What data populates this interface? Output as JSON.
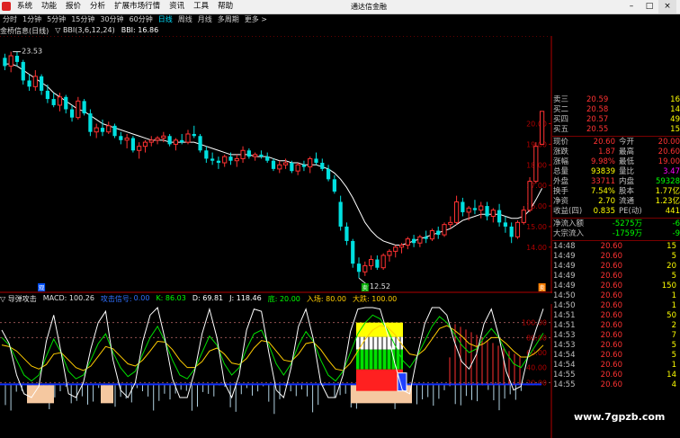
{
  "window": {
    "menu": [
      "系统",
      "功能",
      "报价",
      "分析",
      "扩展市场行情",
      "资讯",
      "工具",
      "帮助"
    ],
    "title": "通达信金融终",
    "controls": [
      "–",
      "□",
      "×"
    ]
  },
  "periods": {
    "tabs": [
      "分时",
      "1分钟",
      "5分钟",
      "15分钟",
      "30分钟",
      "60分钟",
      "日线",
      "周线",
      "月线",
      "多周期",
      "更多 >"
    ],
    "active": "日线"
  },
  "price_legend": {
    "name": "金桥信息(日线)",
    "indicator": "▽ BBI(3,6,12,24)",
    "bbi": "BBI: 16.86"
  },
  "indicator_legend": {
    "name": "▽ 导弹攻击",
    "macd": "MACD: 100.26",
    "flag": "攻击信号:",
    "flag_val": "0.00",
    "k": "K: 86.03",
    "d": "D: 69.81",
    "j": "J: 118.46",
    "low": "底: 20.00",
    "enter": "入场: 80.00",
    "big": "大跌: 100.00"
  },
  "price_axis": [
    "20.00",
    "19.00",
    "18.00",
    "17.00",
    "16.00",
    "15.00",
    "14.00"
  ],
  "indicator_axis": [
    "100.00",
    "80.00",
    "60.00",
    "40.00",
    "20.00"
  ],
  "annotations": {
    "high_label": "23.53",
    "low_label": "12.52",
    "marker_left": "观",
    "marker_right": "卖"
  },
  "quotes": {
    "top_rows": [
      {
        "label": "卖三",
        "price": "20.59",
        "vol": "16"
      },
      {
        "label": "买二",
        "price": "20.58",
        "vol": "14"
      },
      {
        "label": "买四",
        "price": "20.57",
        "vol": "49"
      },
      {
        "label": "买五",
        "price": "20.55",
        "vol": "15"
      }
    ],
    "stats": [
      {
        "l1": "现价",
        "v1": "20.60",
        "l2": "今开",
        "v2": "20.00"
      },
      {
        "l1": "涨跌",
        "v1": "1.87",
        "l2": "最高",
        "v2": "20.60"
      },
      {
        "l1": "涨幅",
        "v1": "9.98%",
        "l2": "最低",
        "v2": "19.00"
      },
      {
        "l1": "总量",
        "v1": "93839",
        "l2": "量比",
        "v2": "3.47"
      },
      {
        "l1": "外盘",
        "v1": "33711",
        "l2": "内盘",
        "v2": "59328"
      },
      {
        "l1": "换手",
        "v1": "7.54%",
        "l2": "股本",
        "v2": "1.77亿"
      },
      {
        "l1": "净资",
        "v1": "2.70",
        "l2": "流通",
        "v2": "1.23亿"
      },
      {
        "l1": "收益(四)",
        "v1": "0.835",
        "l2": "PE(动)",
        "v2": "441"
      }
    ],
    "flows": [
      {
        "label": "净流入额",
        "v1": "-5275万",
        "v2": "-6"
      },
      {
        "label": "大宗流入",
        "v1": "-1759万",
        "v2": "-9"
      }
    ],
    "ticks": [
      {
        "time": "14:48",
        "price": "20.60",
        "vol": "15"
      },
      {
        "time": "14:49",
        "price": "20.60",
        "vol": "5"
      },
      {
        "time": "14:49",
        "price": "20.60",
        "vol": "20"
      },
      {
        "time": "14:49",
        "price": "20.60",
        "vol": "5"
      },
      {
        "time": "14:49",
        "price": "20.60",
        "vol": "150"
      },
      {
        "time": "14:50",
        "price": "20.60",
        "vol": "1"
      },
      {
        "time": "14:50",
        "price": "20.60",
        "vol": "1"
      },
      {
        "time": "14:51",
        "price": "20.60",
        "vol": "50"
      },
      {
        "time": "14:51",
        "price": "20.60",
        "vol": "2"
      },
      {
        "time": "14:53",
        "price": "20.60",
        "vol": "7"
      },
      {
        "time": "14:53",
        "price": "20.60",
        "vol": "5"
      },
      {
        "time": "14:54",
        "price": "20.60",
        "vol": "5"
      },
      {
        "time": "14:54",
        "price": "20.60",
        "vol": "1"
      },
      {
        "time": "14:55",
        "price": "20.60",
        "vol": "14"
      },
      {
        "time": "14:55",
        "price": "20.60",
        "vol": "4"
      }
    ]
  },
  "watermark": "www.7gpzb.com",
  "colors": {
    "up": "#ff3232",
    "down": "#00e0e0",
    "bbi": "#ffffff",
    "axis": "#b00000",
    "label": "#c0c0c0"
  },
  "chart_data": {
    "type": "candlestick",
    "title": "金桥信息(日线)",
    "indicator": "BBI(3,6,12,24)",
    "ylim": [
      12.2,
      24.0
    ],
    "candles": [
      [
        23.2,
        23.4,
        22.6,
        22.8
      ],
      [
        22.8,
        23.5,
        22.5,
        23.3
      ],
      [
        23.3,
        23.5,
        22.8,
        23.0
      ],
      [
        23.0,
        23.1,
        21.9,
        22.1
      ],
      [
        22.1,
        22.4,
        21.6,
        21.8
      ],
      [
        21.8,
        22.6,
        21.6,
        22.3
      ],
      [
        22.3,
        22.4,
        21.4,
        21.6
      ],
      [
        21.6,
        21.9,
        21.0,
        21.2
      ],
      [
        21.2,
        21.5,
        20.8,
        20.9
      ],
      [
        20.9,
        21.5,
        20.6,
        21.3
      ],
      [
        21.3,
        21.4,
        20.5,
        20.7
      ],
      [
        20.7,
        20.9,
        20.1,
        20.3
      ],
      [
        20.3,
        21.3,
        20.2,
        21.1
      ],
      [
        21.1,
        21.2,
        20.4,
        20.5
      ],
      [
        20.5,
        20.7,
        19.4,
        19.6
      ],
      [
        19.6,
        20.0,
        19.3,
        19.8
      ],
      [
        19.8,
        20.2,
        19.4,
        19.6
      ],
      [
        19.6,
        20.1,
        19.5,
        19.9
      ],
      [
        19.9,
        20.0,
        19.3,
        19.4
      ],
      [
        19.4,
        19.6,
        19.0,
        19.2
      ],
      [
        19.2,
        19.5,
        18.8,
        19.3
      ],
      [
        19.3,
        19.4,
        18.6,
        18.7
      ],
      [
        18.7,
        19.1,
        18.3,
        18.9
      ],
      [
        18.9,
        19.2,
        18.6,
        19.1
      ],
      [
        19.1,
        19.4,
        18.9,
        19.2
      ],
      [
        19.2,
        19.4,
        19.0,
        19.3
      ],
      [
        19.3,
        19.6,
        19.1,
        19.4
      ],
      [
        19.4,
        19.5,
        18.9,
        19.0
      ],
      [
        19.0,
        19.3,
        18.7,
        19.2
      ],
      [
        19.2,
        19.5,
        19.0,
        19.1
      ],
      [
        19.1,
        19.7,
        19.0,
        19.5
      ],
      [
        19.5,
        19.9,
        19.3,
        19.4
      ],
      [
        19.4,
        19.5,
        18.6,
        18.7
      ],
      [
        18.7,
        18.9,
        18.1,
        18.3
      ],
      [
        18.3,
        18.6,
        18.0,
        18.2
      ],
      [
        18.2,
        18.4,
        17.8,
        18.1
      ],
      [
        18.1,
        18.5,
        17.9,
        18.4
      ],
      [
        18.4,
        18.6,
        18.0,
        18.2
      ],
      [
        18.2,
        18.5,
        17.9,
        18.3
      ],
      [
        18.3,
        18.9,
        18.1,
        18.7
      ],
      [
        18.7,
        18.8,
        18.3,
        18.4
      ],
      [
        18.4,
        18.6,
        18.2,
        18.5
      ],
      [
        18.5,
        18.7,
        18.3,
        18.4
      ],
      [
        18.4,
        18.6,
        18.1,
        18.2
      ],
      [
        18.2,
        18.3,
        17.7,
        17.8
      ],
      [
        17.8,
        18.2,
        17.6,
        18.0
      ],
      [
        18.0,
        18.3,
        17.8,
        18.1
      ],
      [
        18.1,
        18.2,
        17.6,
        17.7
      ],
      [
        17.7,
        18.1,
        17.5,
        18.0
      ],
      [
        18.0,
        18.2,
        17.7,
        17.9
      ],
      [
        17.9,
        18.4,
        17.6,
        18.3
      ],
      [
        18.3,
        18.6,
        18.0,
        18.1
      ],
      [
        18.1,
        18.3,
        17.7,
        17.8
      ],
      [
        17.8,
        18.0,
        17.2,
        17.3
      ],
      [
        17.3,
        17.5,
        16.6,
        16.7
      ],
      [
        16.2,
        16.5,
        14.8,
        15.0
      ],
      [
        15.0,
        15.2,
        14.1,
        14.3
      ],
      [
        14.3,
        14.4,
        13.0,
        13.2
      ],
      [
        13.2,
        13.5,
        12.5,
        12.8
      ],
      [
        12.8,
        13.3,
        12.6,
        13.1
      ],
      [
        13.1,
        13.6,
        12.9,
        13.4
      ],
      [
        13.4,
        13.6,
        12.9,
        13.0
      ],
      [
        13.0,
        13.7,
        12.9,
        13.6
      ],
      [
        13.6,
        13.9,
        13.3,
        13.8
      ],
      [
        13.8,
        14.1,
        13.5,
        14.0
      ],
      [
        14.0,
        14.2,
        13.7,
        14.1
      ],
      [
        14.1,
        14.5,
        13.9,
        14.4
      ],
      [
        14.4,
        14.6,
        14.0,
        14.2
      ],
      [
        14.2,
        14.6,
        14.0,
        14.5
      ],
      [
        14.5,
        14.8,
        14.2,
        14.4
      ],
      [
        14.4,
        14.9,
        14.3,
        14.8
      ],
      [
        14.8,
        15.0,
        14.4,
        14.6
      ],
      [
        14.6,
        15.2,
        14.5,
        15.1
      ],
      [
        15.1,
        15.5,
        14.9,
        15.2
      ],
      [
        15.2,
        16.5,
        15.1,
        16.2
      ],
      [
        16.2,
        16.4,
        15.5,
        15.7
      ],
      [
        15.7,
        16.0,
        15.3,
        15.9
      ],
      [
        15.9,
        16.3,
        15.6,
        15.8
      ],
      [
        15.8,
        16.2,
        15.4,
        16.0
      ],
      [
        16.0,
        16.2,
        15.3,
        15.5
      ],
      [
        15.5,
        15.9,
        15.2,
        15.8
      ],
      [
        15.8,
        16.1,
        15.0,
        15.2
      ],
      [
        15.2,
        15.5,
        14.7,
        15.0
      ],
      [
        15.0,
        15.2,
        14.2,
        14.5
      ],
      [
        14.5,
        15.3,
        14.4,
        15.2
      ],
      [
        15.2,
        16.0,
        15.1,
        15.8
      ],
      [
        15.8,
        17.4,
        15.7,
        17.2
      ],
      [
        17.2,
        19.1,
        17.1,
        18.9
      ],
      [
        19.0,
        20.6,
        19.0,
        20.6
      ]
    ],
    "bbi": [
      22.9,
      22.9,
      22.8,
      22.6,
      22.4,
      22.2,
      22.0,
      21.8,
      21.5,
      21.3,
      21.1,
      20.9,
      20.7,
      20.6,
      20.4,
      20.2,
      20.0,
      19.9,
      19.8,
      19.7,
      19.6,
      19.5,
      19.4,
      19.3,
      19.2,
      19.2,
      19.2,
      19.1,
      19.1,
      19.1,
      19.1,
      19.1,
      19.0,
      18.9,
      18.8,
      18.7,
      18.6,
      18.5,
      18.5,
      18.5,
      18.5,
      18.4,
      18.4,
      18.4,
      18.3,
      18.2,
      18.2,
      18.1,
      18.1,
      18.0,
      18.0,
      18.0,
      17.9,
      17.8,
      17.6,
      17.3,
      16.9,
      16.4,
      15.8,
      15.2,
      14.8,
      14.5,
      14.3,
      14.2,
      14.1,
      14.1,
      14.2,
      14.3,
      14.4,
      14.5,
      14.6,
      14.7,
      14.8,
      14.9,
      15.1,
      15.3,
      15.4,
      15.5,
      15.6,
      15.6,
      15.6,
      15.6,
      15.5,
      15.4,
      15.4,
      15.5,
      15.8,
      16.3,
      16.86
    ],
    "indicator_panel": {
      "name": "导弹攻击",
      "ylim": [
        0,
        120
      ],
      "levels": [
        20,
        80,
        100
      ],
      "k": [
        80,
        70,
        50,
        30,
        22,
        30,
        55,
        78,
        60,
        35,
        25,
        30,
        50,
        72,
        85,
        60,
        40,
        28,
        35,
        58,
        80,
        95,
        75,
        50,
        30,
        25,
        38,
        60,
        82,
        70,
        45,
        30,
        40,
        65,
        85,
        90,
        70,
        45,
        30,
        45,
        70,
        88,
        75,
        50,
        30,
        22,
        35,
        60,
        85,
        100,
        110,
        105,
        90,
        70,
        50,
        40,
        55,
        75,
        95,
        108,
        100,
        85,
        70,
        60,
        65,
        80,
        92,
        80,
        60,
        45,
        40,
        55,
        70,
        86
      ],
      "d": [
        70,
        68,
        62,
        52,
        42,
        38,
        44,
        58,
        60,
        50,
        40,
        36,
        42,
        55,
        68,
        65,
        55,
        45,
        42,
        50,
        62,
        75,
        74,
        64,
        50,
        40,
        40,
        48,
        62,
        66,
        58,
        46,
        44,
        52,
        66,
        76,
        74,
        62,
        50,
        48,
        58,
        72,
        74,
        64,
        50,
        38,
        36,
        46,
        62,
        78,
        90,
        96,
        94,
        84,
        70,
        58,
        56,
        64,
        78,
        92,
        96,
        90,
        82,
        72,
        68,
        72,
        80,
        80,
        72,
        62,
        54,
        54,
        60,
        69.81
      ],
      "j": [
        90,
        72,
        30,
        5,
        0,
        15,
        75,
        110,
        60,
        5,
        0,
        20,
        65,
        100,
        115,
        50,
        10,
        0,
        20,
        75,
        110,
        120,
        78,
        25,
        0,
        0,
        35,
        85,
        118,
        80,
        20,
        0,
        30,
        90,
        118,
        115,
        60,
        10,
        0,
        40,
        95,
        118,
        78,
        20,
        0,
        0,
        30,
        88,
        118,
        120,
        120,
        118,
        85,
        45,
        10,
        5,
        55,
        98,
        120,
        120,
        110,
        75,
        48,
        38,
        58,
        98,
        118,
        82,
        35,
        10,
        15,
        58,
        90,
        118.46
      ]
    }
  }
}
